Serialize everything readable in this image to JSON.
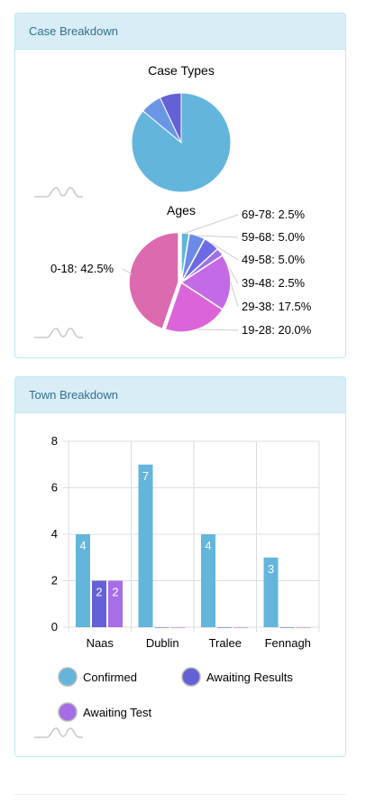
{
  "panels": {
    "case": {
      "title": "Case Breakdown"
    },
    "town": {
      "title": "Town Breakdown"
    }
  },
  "chart_data": [
    {
      "type": "pie",
      "title": "Case Types",
      "slices": [
        {
          "label": "",
          "value": 86,
          "color": "#63b5dc"
        },
        {
          "label": "",
          "value": 7,
          "color": "#6a96e6"
        },
        {
          "label": "",
          "value": 7,
          "color": "#6461d6"
        }
      ]
    },
    {
      "type": "pie",
      "title": "Ages",
      "slices": [
        {
          "label": "0-18: 42.5%",
          "value": 42.5,
          "color": "#dc6aae"
        },
        {
          "label": "19-28: 20.0%",
          "value": 20.0,
          "color": "#db64d9"
        },
        {
          "label": "29-38: 17.5%",
          "value": 17.5,
          "color": "#c46ae6"
        },
        {
          "label": "39-48: 2.5%",
          "value": 2.5,
          "color": "#9f6fe6"
        },
        {
          "label": "49-58: 5.0%",
          "value": 5.0,
          "color": "#6e6ae4"
        },
        {
          "label": "59-68: 5.0%",
          "value": 5.0,
          "color": "#6a8be6"
        },
        {
          "label": "69-78: 2.5%",
          "value": 2.5,
          "color": "#63b5dc"
        }
      ]
    },
    {
      "type": "bar",
      "categories": [
        "Naas",
        "Dublin",
        "Tralee",
        "Fennagh"
      ],
      "series": [
        {
          "name": "Confirmed",
          "values": [
            4,
            7,
            4,
            3
          ],
          "color": "#63b5dc"
        },
        {
          "name": "Awaiting Results",
          "values": [
            2,
            0,
            0,
            0
          ],
          "color": "#6461d6"
        },
        {
          "name": "Awaiting Test",
          "values": [
            2,
            0,
            0,
            0
          ],
          "color": "#a66ee6"
        }
      ],
      "ylim": [
        0,
        8
      ],
      "yticks": [
        0,
        2,
        4,
        6,
        8
      ],
      "grid": true,
      "legend": "bottom"
    }
  ]
}
